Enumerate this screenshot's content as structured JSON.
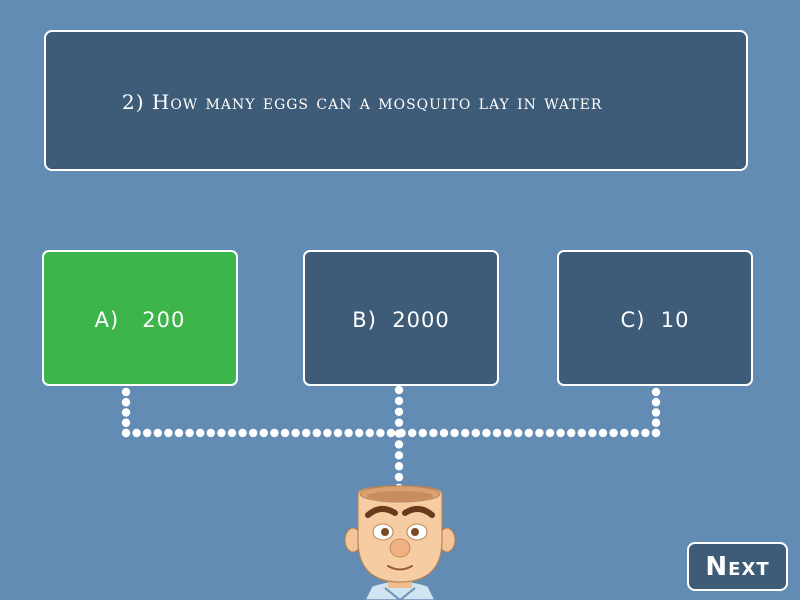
{
  "question": {
    "text": "2) How many eggs can a mosquito lay in water"
  },
  "answers": [
    {
      "id": "a",
      "label": "A)   200",
      "state": "correct"
    },
    {
      "id": "b",
      "label": "B)  2000",
      "state": "default"
    },
    {
      "id": "c",
      "label": "C)  10",
      "state": "default"
    }
  ],
  "next_button": {
    "label": "Next"
  },
  "colors": {
    "background": "#628cb3",
    "panel": "#3e5b77",
    "correct": "#3cb54a",
    "border": "#ffffff"
  },
  "icons": {
    "character": "bald-boy-head-icon",
    "connector": "dotted-line-connector"
  }
}
